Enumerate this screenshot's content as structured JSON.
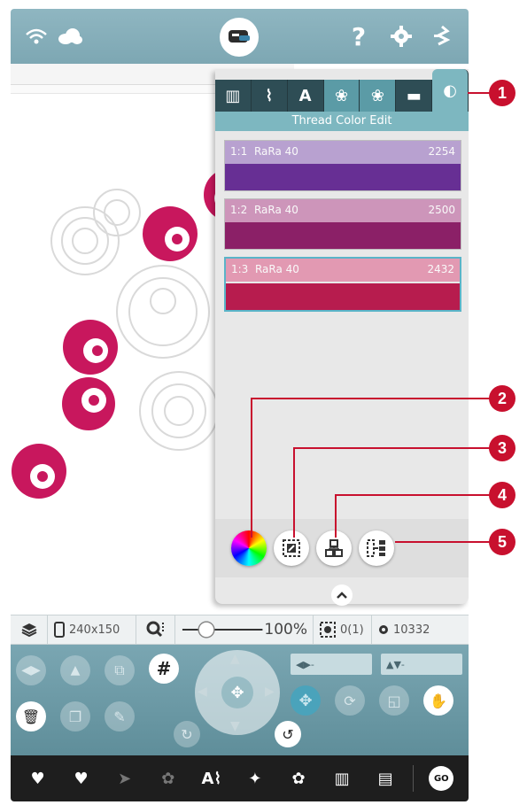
{
  "panel": {
    "title": "Thread Color Edit",
    "tabs": [
      "▥",
      "⌇",
      "A",
      "❀",
      "❀",
      "▬",
      "◐"
    ],
    "threads": [
      {
        "index": "1:1",
        "name": "RaRa 40",
        "code": "2254",
        "color": "#672f94",
        "header_color": "#a98ac9"
      },
      {
        "index": "1:2",
        "name": "RaRa 40",
        "code": "2500",
        "color": "#8b2067",
        "header_color": "#c57aab"
      },
      {
        "index": "1:3",
        "name": "RaRa 40",
        "code": "2432",
        "color": "#b71c4e",
        "header_color": "#e07fa0"
      }
    ],
    "tools": [
      "color-wheel",
      "color-replace",
      "group",
      "sort"
    ]
  },
  "status": {
    "hoop": "240x150",
    "zoom": "100%",
    "zoom_level_pct": 100,
    "selection": "0(1)",
    "stitches": "10332"
  },
  "controls": {
    "field_a": "◀▶-",
    "field_b": "▲▼-"
  },
  "bottom": {
    "go_label": "GO",
    "text_tool": "A⌇"
  },
  "callouts": [
    "1",
    "2",
    "3",
    "4",
    "5"
  ],
  "colors": {
    "accent": "#c8102e",
    "embroidery": "#c8175d",
    "topbar": "#8fb6c1",
    "panel_header": "#7db7c0"
  }
}
